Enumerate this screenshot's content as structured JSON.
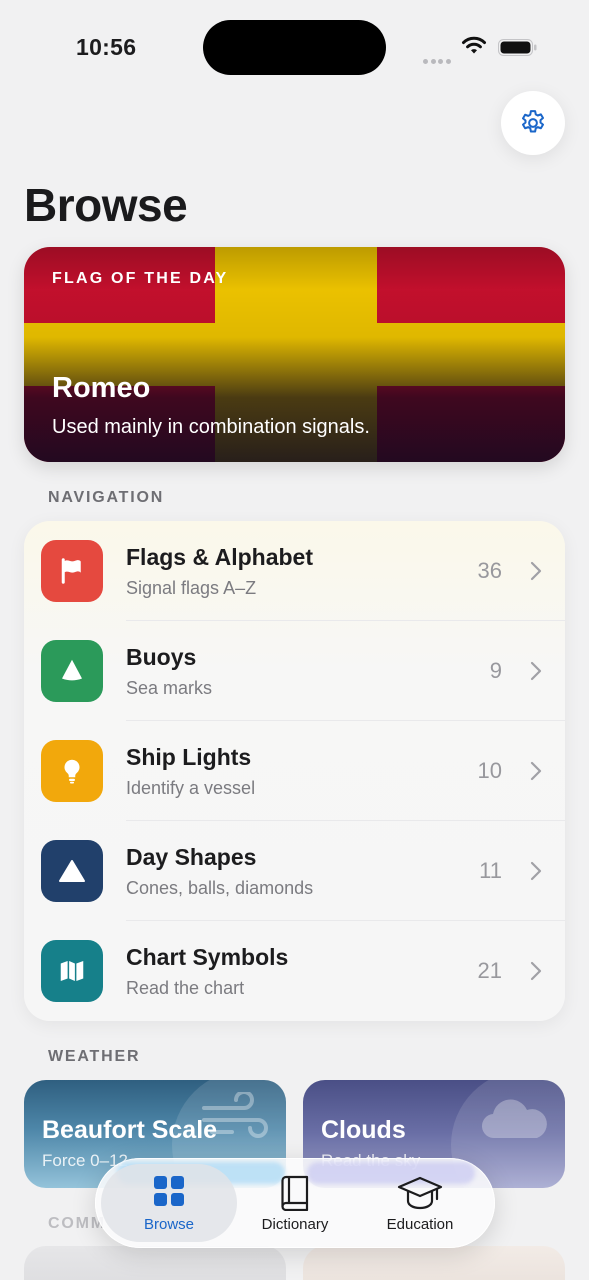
{
  "status_bar": {
    "time": "10:56"
  },
  "header": {
    "title": "Browse"
  },
  "flag_of_day": {
    "kicker": "FLAG OF THE DAY",
    "name": "Romeo",
    "description": "Used mainly in combination signals.",
    "colors": {
      "field": "#c8102e",
      "cross": "#f2c700"
    }
  },
  "navigation": {
    "section_label": "NAVIGATION",
    "items": [
      {
        "title": "Flags & Alphabet",
        "subtitle": "Signal flags A–Z",
        "count": "36",
        "icon": "flag-icon",
        "color": "#e5493f"
      },
      {
        "title": "Buoys",
        "subtitle": "Sea marks",
        "count": "9",
        "icon": "buoy-icon",
        "color": "#2b9a5a"
      },
      {
        "title": "Ship Lights",
        "subtitle": "Identify a vessel",
        "count": "10",
        "icon": "lightbulb-icon",
        "color": "#f2a80c"
      },
      {
        "title": "Day Shapes",
        "subtitle": "Cones, balls, diamonds",
        "count": "11",
        "icon": "triangle-icon",
        "color": "#21406b"
      },
      {
        "title": "Chart Symbols",
        "subtitle": "Read the chart",
        "count": "21",
        "icon": "map-icon",
        "color": "#16808a"
      }
    ]
  },
  "weather": {
    "section_label": "WEATHER",
    "cards": [
      {
        "title": "Beaufort Scale",
        "subtitle": "Force 0–12",
        "icon": "wind-icon"
      },
      {
        "title": "Clouds",
        "subtitle": "Read the sky",
        "icon": "cloud-icon"
      }
    ]
  },
  "communication": {
    "section_label": "COMM"
  },
  "tab_bar": {
    "active": "Browse",
    "tabs": [
      {
        "label": "Browse",
        "icon": "grid-icon"
      },
      {
        "label": "Dictionary",
        "icon": "book-icon"
      },
      {
        "label": "Education",
        "icon": "graduation-cap-icon"
      }
    ]
  },
  "accent_color": "#1a66c9"
}
